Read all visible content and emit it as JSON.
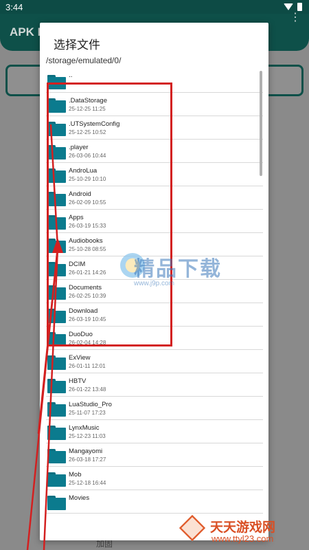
{
  "status_bar": {
    "time": "3:44"
  },
  "background_app": {
    "title": "APK E",
    "bottom_label": "加固"
  },
  "dialog": {
    "title": "选择文件",
    "path": "/storage/emulated/0/",
    "items": [
      {
        "name": "..",
        "date": ""
      },
      {
        "name": ".DataStorage",
        "date": "25-12-25 11:25"
      },
      {
        "name": ".UTSystemConfig",
        "date": "25-12-25 10:52"
      },
      {
        "name": ".player",
        "date": "26-03-06 10:44"
      },
      {
        "name": "AndroLua",
        "date": "25-10-29 10:10"
      },
      {
        "name": "Android",
        "date": "26-02-09 10:55"
      },
      {
        "name": "Apps",
        "date": "26-03-19 15:33"
      },
      {
        "name": "Audiobooks",
        "date": "25-10-28 08:55"
      },
      {
        "name": "DCIM",
        "date": "26-01-21 14:26"
      },
      {
        "name": "Documents",
        "date": "26-02-25 10:39"
      },
      {
        "name": "Download",
        "date": "26-03-19 10:45"
      },
      {
        "name": "DuoDuo",
        "date": "26-02-04 14:28"
      },
      {
        "name": "ExView",
        "date": "26-01-11 12:01"
      },
      {
        "name": "HBTV",
        "date": "26-01-22 13:48"
      },
      {
        "name": "LuaStudio_Pro",
        "date": "25-11-07 17:23"
      },
      {
        "name": "LynxMusic",
        "date": "25-12-23 11:03"
      },
      {
        "name": "Mangayomi",
        "date": "26-03-18 17:27"
      },
      {
        "name": "Mob",
        "date": "25-12-18 16:44"
      },
      {
        "name": "Movies",
        "date": ""
      }
    ]
  },
  "watermarks": {
    "center_text": "精品下载",
    "center_url": "www.j9p.com",
    "corner_text": "天天游戏网",
    "corner_url": "www.ttyl23.com"
  },
  "colors": {
    "folder": "#0b7b8e",
    "annotation": "#d32020",
    "app_bar": "#0e5049"
  }
}
